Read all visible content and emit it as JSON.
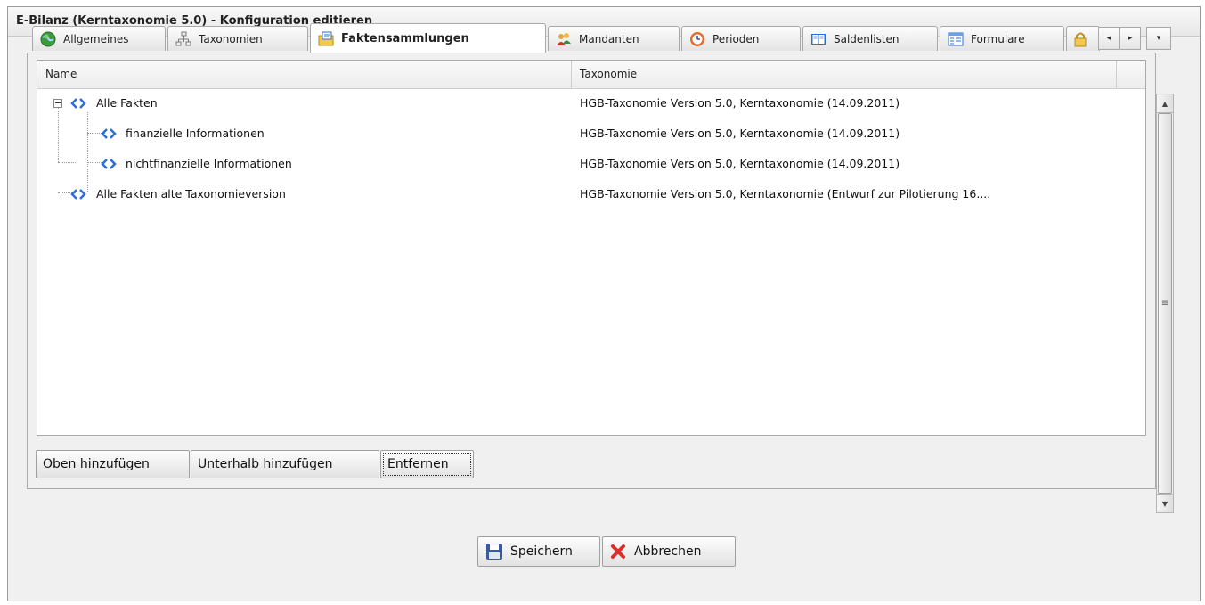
{
  "window": {
    "title": "E-Bilanz (Kerntaxonomie 5.0) - Konfiguration editieren"
  },
  "tabs": [
    {
      "label": "Allgemeines",
      "icon": "globe-icon"
    },
    {
      "label": "Taxonomien",
      "icon": "hierarchy-icon"
    },
    {
      "label": "Faktensammlungen",
      "icon": "folder-icon",
      "active": true
    },
    {
      "label": "Mandanten",
      "icon": "users-icon"
    },
    {
      "label": "Perioden",
      "icon": "clock-icon"
    },
    {
      "label": "Saldenlisten",
      "icon": "book-icon"
    },
    {
      "label": "Formulare",
      "icon": "form-icon"
    }
  ],
  "tab_overflow": {
    "hidden_tab_icon": "lock-icon",
    "prev": "◂",
    "next": "▸",
    "menu": "▾"
  },
  "grid": {
    "columns": {
      "name": "Name",
      "taxonomy": "Taxonomie"
    },
    "rows": [
      {
        "name": "Alle Fakten",
        "taxonomy": "HGB-Taxonomie Version 5.0, Kerntaxonomie (14.09.2011)",
        "level": 0,
        "expanded": true
      },
      {
        "name": "finanzielle Informationen",
        "taxonomy": "HGB-Taxonomie Version 5.0, Kerntaxonomie (14.09.2011)",
        "level": 1
      },
      {
        "name": "nichtfinanzielle Informationen",
        "taxonomy": "HGB-Taxonomie Version 5.0, Kerntaxonomie (14.09.2011)",
        "level": 1
      },
      {
        "name": "Alle Fakten alte Taxonomieversion",
        "taxonomy": "HGB-Taxonomie Version 5.0, Kerntaxonomie (Entwurf zur Pilotierung 16....",
        "level": 0
      }
    ]
  },
  "panel_buttons": {
    "add_above": "Oben hinzufügen",
    "add_below": "Unterhalb hinzufügen",
    "remove": "Entfernen"
  },
  "dialog_buttons": {
    "save": "Speichern",
    "cancel": "Abbrechen"
  },
  "scrollbar": {
    "up": "▲",
    "down": "▼",
    "grip": "≡"
  },
  "colors": {
    "fact_icon": "#2b6fd6",
    "cancel_x": "#d9302a",
    "save_disk": "#3a57a8"
  }
}
